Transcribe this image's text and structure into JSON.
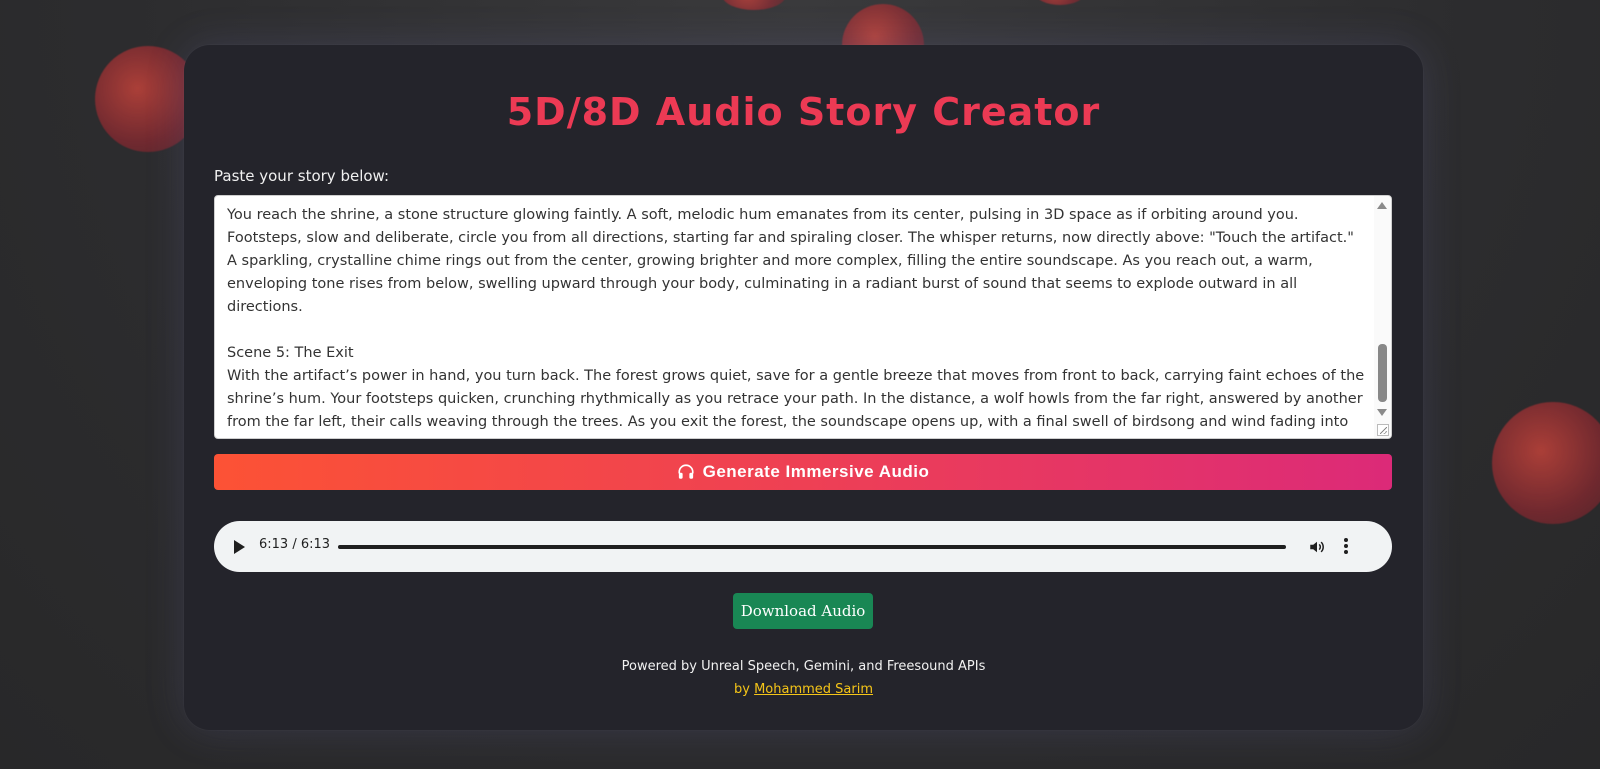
{
  "app": {
    "title": "5D/8D Audio Story Creator"
  },
  "story": {
    "label": "Paste your story below:",
    "text": "You reach the shrine, a stone structure glowing faintly. A soft, melodic hum emanates from its center, pulsing in 3D space as if orbiting around you. Footsteps, slow and deliberate, circle you from all directions, starting far and spiraling closer. The whisper returns, now directly above: \"Touch the artifact.\" A sparkling, crystalline chime rings out from the center, growing brighter and more complex, filling the entire soundscape. As you reach out, a warm, enveloping tone rises from below, swelling upward through your body, culminating in a radiant burst of sound that seems to explode outward in all directions.\n\nScene 5: The Exit\nWith the artifact’s power in hand, you turn back. The forest grows quiet, save for a gentle breeze that moves from front to back, carrying faint echoes of the shrine’s hum. Your footsteps quicken, crunching rhythmically as you retrace your path. In the distance, a wolf howls from the far right, answered by another from the far left, their calls weaving through the trees. As you exit the forest, the soundscape opens up, with a final swell of birdsong and wind fading into silence behind you."
  },
  "generate_button": {
    "label": "Generate Immersive Audio",
    "icon": "headphones-icon"
  },
  "audio_player": {
    "time": "6:13 / 6:13",
    "progress": 1.0
  },
  "download_button": {
    "label": "Download Audio"
  },
  "footer": {
    "powered_by": "Powered by Unreal Speech, Gemini, and Freesound APIs",
    "by_prefix": "by",
    "author": "Mohammed Sarim"
  },
  "colors": {
    "title": "#ec3a54",
    "button_gradient_start": "#fc5235",
    "button_gradient_end": "#dc2a78",
    "download_button": "#198754",
    "author_link": "#f5c518"
  }
}
